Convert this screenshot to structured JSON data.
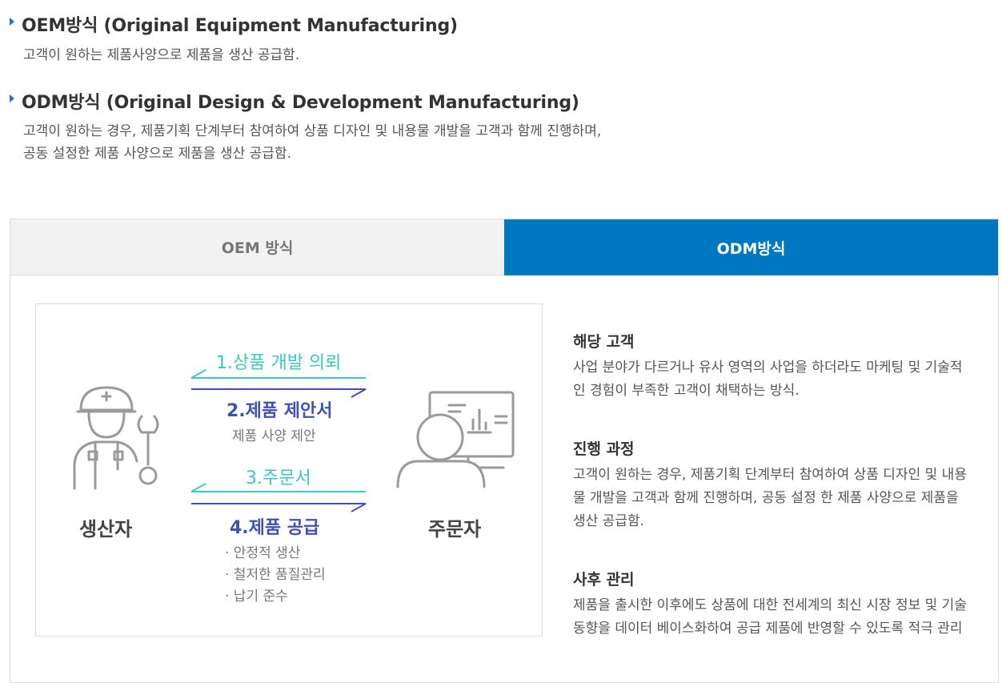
{
  "sections": [
    {
      "title": "OEM방식 (Original Equipment Manufacturing)",
      "lines": [
        "고객이 원하는 제품사양으로 제품을 생산 공급함."
      ]
    },
    {
      "title": "ODM방식 (Original Design & Development Manufacturing)",
      "lines": [
        "고객이 원하는 경우, 제품기획 단계부터 참여하여 상품 디자인 및 내용물 개발을 고객과 함께 진행하며,",
        "공동 설정한 제품 사양으로 제품을 생산 공급함."
      ]
    }
  ],
  "tabs": [
    {
      "label": "OEM 방식",
      "active": false
    },
    {
      "label": "ODM방식",
      "active": true
    }
  ],
  "diagram": {
    "step1": "1.상품 개발 의뢰",
    "step2": "2.제품 제안서",
    "step2_sub": "제품 사양 제안",
    "step3": "3.주문서",
    "step4": "4.제품 공급",
    "step4_items": [
      "· 안정적 생산",
      "· 철저한 품질관리",
      "· 납기 준수"
    ],
    "producer": "생산자",
    "orderer": "주문자"
  },
  "info": [
    {
      "heading": "해당 고객",
      "text": "사업 분야가 다르거나 유사 영역의 사업을 하더라도 마케팅 및 기술적인 경험이 부족한 고객이 채택하는 방식."
    },
    {
      "heading": "진행 과정",
      "text": "고객이 원하는 경우, 제품기획 단계부터 참여하여 상품 디자인 및 내용물 개발을 고객과 함께 진행하며, 공동 설정 한 제품 사양으로 제품을 생산 공급함."
    },
    {
      "heading": "사후 관리",
      "text": "제품을 출시한 이후에도 상품에 대한 전세계의 최신 시장 정보 및 기술 동향을 데이터 베이스화하여 공급 제품에 반영할 수 있도록 적극 관리"
    }
  ],
  "colors": {
    "accent": "#0078c1",
    "teal": "#3cc6c2",
    "blue": "#3f51b5"
  }
}
